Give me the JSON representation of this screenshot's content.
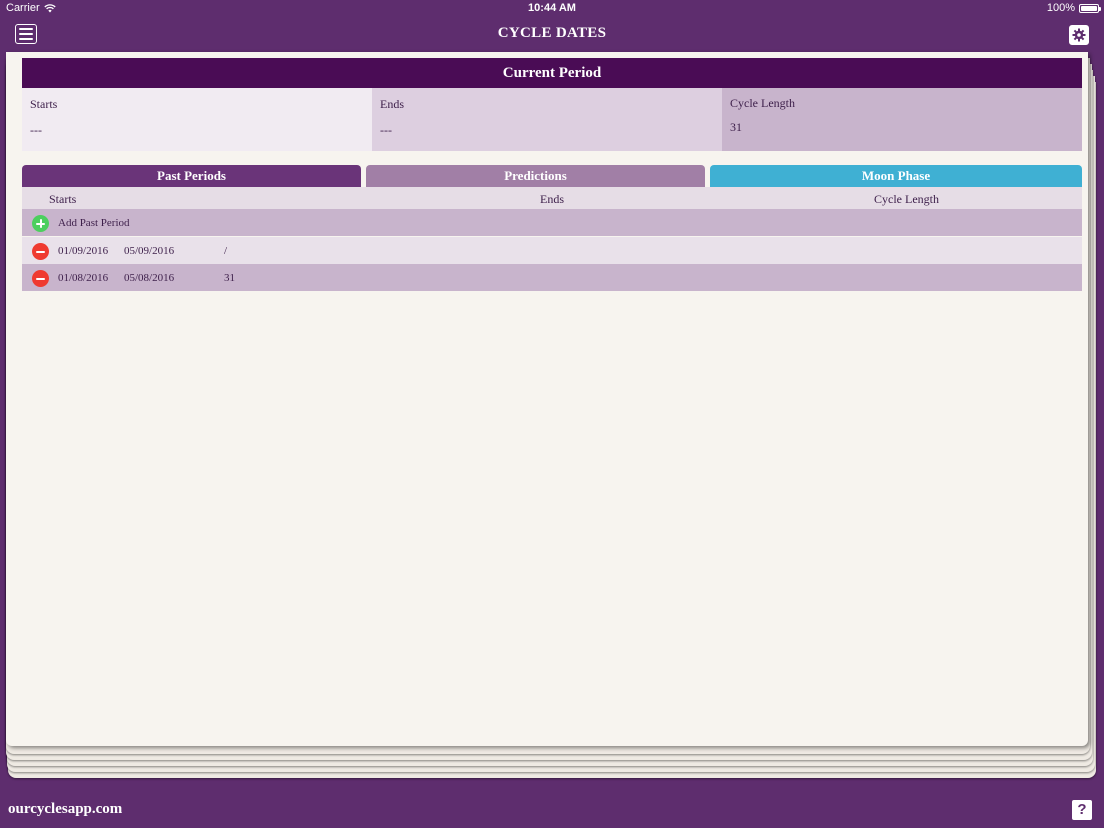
{
  "status_bar": {
    "carrier": "Carrier",
    "time": "10:44 AM",
    "battery": "100%"
  },
  "nav": {
    "title": "CYCLE DATES",
    "menu_icon": "hamburger-menu-icon",
    "settings_icon": "gear-icon"
  },
  "current_period": {
    "title": "Current Period",
    "starts_label": "Starts",
    "starts_value": "---",
    "ends_label": "Ends",
    "ends_value": "---",
    "cycle_label": "Cycle Length",
    "cycle_value": "31"
  },
  "tabs": [
    {
      "label": "Past Periods",
      "color": "#6a3479"
    },
    {
      "label": "Predictions",
      "color": "#a17fa6"
    },
    {
      "label": "Moon Phase",
      "color": "#3fb0d3"
    }
  ],
  "table": {
    "headers": [
      "Starts",
      "Ends",
      "Cycle Length"
    ],
    "add_label": "Add Past Period",
    "rows": [
      {
        "start": "01/09/2016",
        "end": "05/09/2016",
        "cycle": "/"
      },
      {
        "start": "01/08/2016",
        "end": "05/08/2016",
        "cycle": "31"
      }
    ]
  },
  "footer": {
    "link": "ourcyclesapp.com",
    "help_label": "?"
  },
  "colors": {
    "brand": "#5e2d6e",
    "header_dark": "#4a0c55",
    "add_green": "#4ccf5e",
    "remove_red": "#ef3a30"
  }
}
